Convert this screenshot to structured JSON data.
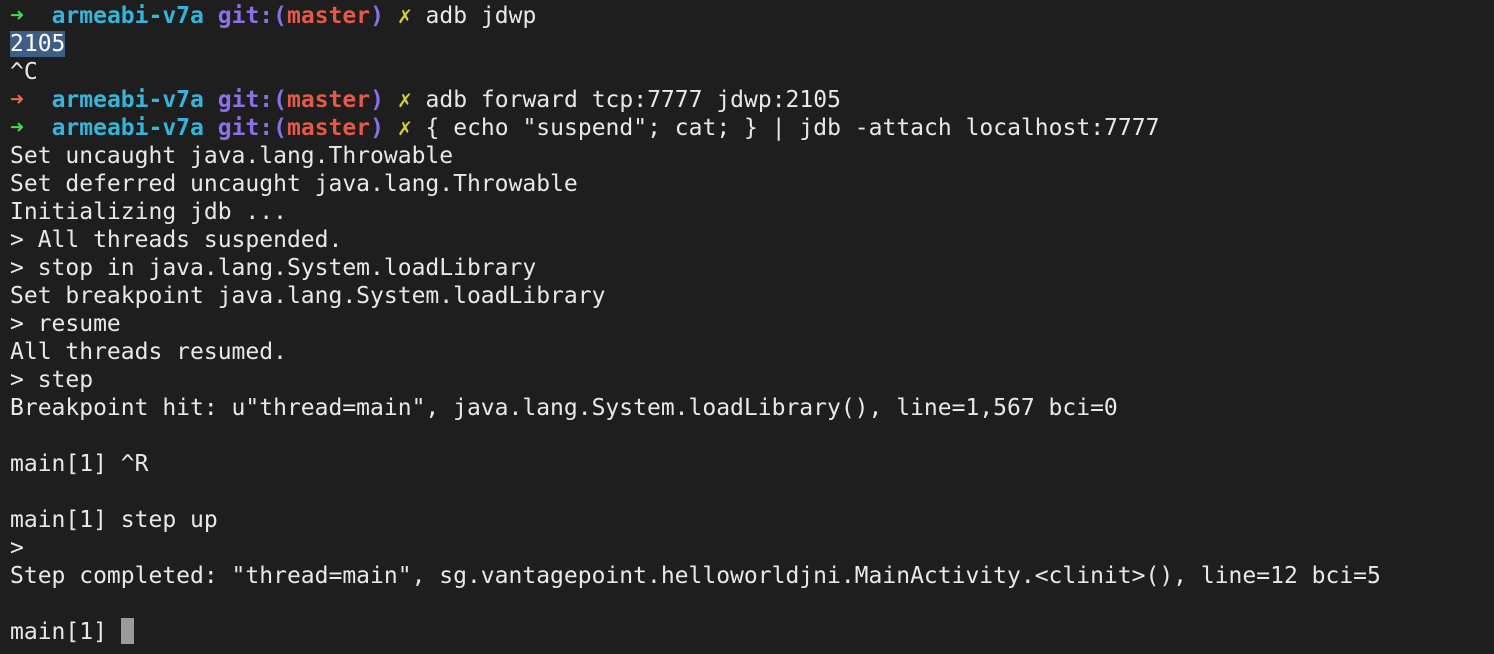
{
  "prompt": {
    "arrow": "➜",
    "dir": "armeabi-v7a",
    "git_prefix": "git:(",
    "branch": "master",
    "git_suffix": ")",
    "dirty": "✗"
  },
  "lines": [
    {
      "kind": "prompt",
      "status": "ok",
      "command": "adb jdwp"
    },
    {
      "kind": "selected",
      "text": "2105"
    },
    {
      "kind": "out",
      "text": "^C"
    },
    {
      "kind": "prompt",
      "status": "err",
      "command": "adb forward tcp:7777 jdwp:2105"
    },
    {
      "kind": "prompt",
      "status": "ok",
      "command": "{ echo \"suspend\"; cat; } | jdb -attach localhost:7777"
    },
    {
      "kind": "out",
      "text": "Set uncaught java.lang.Throwable"
    },
    {
      "kind": "out",
      "text": "Set deferred uncaught java.lang.Throwable"
    },
    {
      "kind": "out",
      "text": "Initializing jdb ..."
    },
    {
      "kind": "out",
      "text": "> All threads suspended."
    },
    {
      "kind": "out",
      "text": "> stop in java.lang.System.loadLibrary"
    },
    {
      "kind": "out",
      "text": "Set breakpoint java.lang.System.loadLibrary"
    },
    {
      "kind": "out",
      "text": "> resume"
    },
    {
      "kind": "out",
      "text": "All threads resumed."
    },
    {
      "kind": "out",
      "text": "> step"
    },
    {
      "kind": "out",
      "text": "Breakpoint hit: u\"thread=main\", java.lang.System.loadLibrary(), line=1,567 bci=0"
    },
    {
      "kind": "out",
      "text": ""
    },
    {
      "kind": "out",
      "text": "main[1] ^R"
    },
    {
      "kind": "out",
      "text": ""
    },
    {
      "kind": "out",
      "text": "main[1] step up"
    },
    {
      "kind": "out",
      "text": ">"
    },
    {
      "kind": "out",
      "text": "Step completed: \"thread=main\", sg.vantagepoint.helloworldjni.MainActivity.<clinit>(), line=12 bci=5"
    },
    {
      "kind": "out",
      "text": ""
    },
    {
      "kind": "cursor",
      "text": "main[1] "
    }
  ],
  "colors": {
    "background": "#1e1e1e",
    "foreground": "#e8e8e8",
    "arrow_ok": "#3ddc54",
    "arrow_err": "#f06a4a",
    "dir": "#39b4d9",
    "git": "#8d6fe8",
    "branch": "#e35a4a",
    "dirty": "#d6cf3a",
    "selection": "#3f5e86",
    "cursor": "#9a9a9a"
  }
}
